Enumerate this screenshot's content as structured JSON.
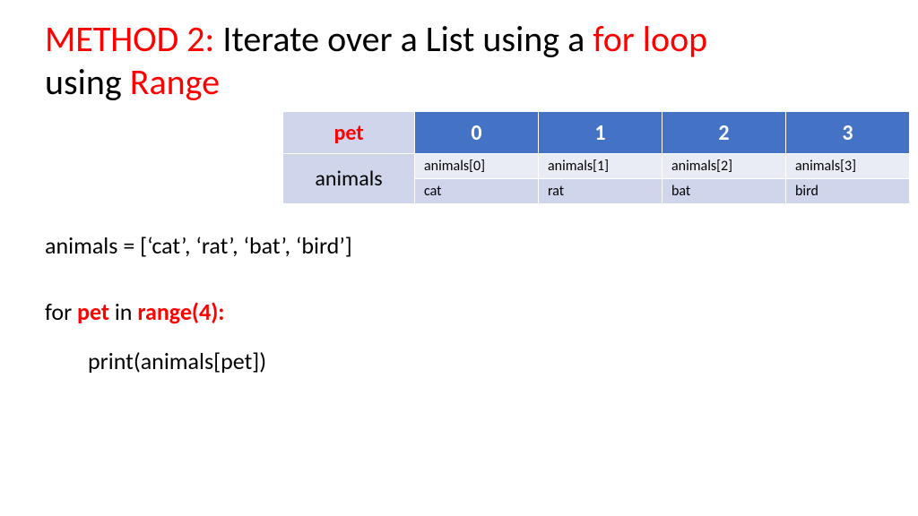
{
  "title": {
    "p1": "METHOD 2: ",
    "p2": "Iterate over a List using a ",
    "p3": "for loop",
    "p4": "using ",
    "p5": "Range"
  },
  "table": {
    "header0": "pet",
    "header1": "0",
    "header2": "1",
    "header3": "2",
    "header4": "3",
    "rowLabel": "animals",
    "r1c1": "animals[0]",
    "r1c2": "animals[1]",
    "r1c3": "animals[2]",
    "r1c4": "animals[3]",
    "r2c1": "cat",
    "r2c2": "rat",
    "r2c3": "bat",
    "r2c4": "bird"
  },
  "code": {
    "line1": "animals = [‘cat’, ‘rat’, ‘bat’, ‘bird’]",
    "line2a": "for ",
    "line2b": "pet",
    "line2c": " in ",
    "line2d": "range(4):",
    "line3": "print(animals[pet])"
  }
}
